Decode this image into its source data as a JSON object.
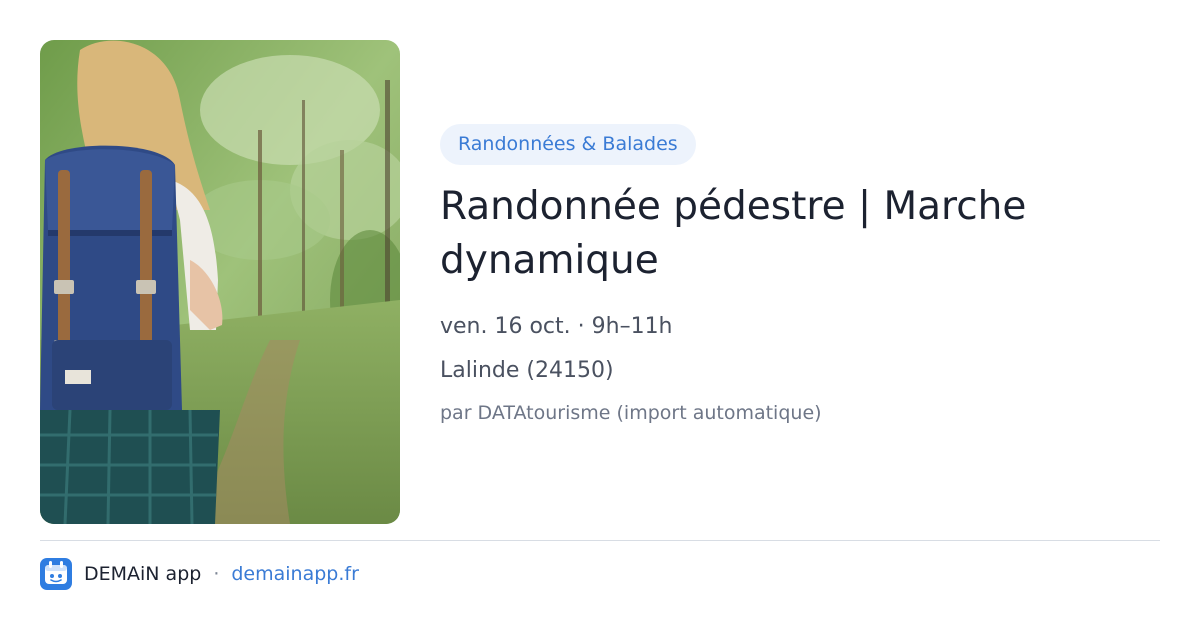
{
  "event": {
    "category": "Randonnées & Balades",
    "title": "Randonnée pédestre | Marche dynamique",
    "datetime": "ven. 16 oct. · 9h–11h",
    "location": "Lalinde (24150)",
    "source": "par DATAtourisme (import automatique)"
  },
  "footer": {
    "app_name": "DEMAiN app",
    "separator": "·",
    "site": "demainapp.fr"
  },
  "colors": {
    "accent": "#3a7bd5",
    "badge_bg": "#edf3fc",
    "title": "#1c2230"
  },
  "image": {
    "subject": "hiker with blue backpack walking on forest trail"
  },
  "icons": {
    "logo": "demain-logo-icon"
  }
}
